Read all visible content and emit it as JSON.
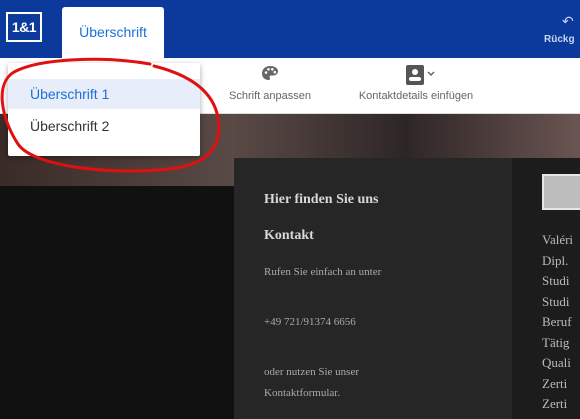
{
  "header": {
    "logo_text": "1&1",
    "active_tab": "Überschrift",
    "undo_label": "Rückg"
  },
  "toolbar": {
    "font_label": "Schrift anpassen",
    "contact_label": "Kontaktdetails einfügen"
  },
  "dropdown": {
    "items": [
      "Überschrift 1",
      "Überschrift 2"
    ],
    "selected": "Überschrift 1"
  },
  "content": {
    "heading_find": "Hier finden Sie uns",
    "heading_contact": "Kontakt",
    "call_text": "Rufen Sie einfach an unter",
    "phone": "+49 721/91374 6656",
    "or_text": "oder nutzen Sie unser",
    "form_text": "Kontaktformular."
  },
  "right_list": [
    "Valéri",
    "Dipl.",
    "Studi",
    "Studi",
    "Beruf",
    "Tätig",
    "Quali",
    "Zerti",
    "Zerti"
  ],
  "colors": {
    "header_bg": "#0b3a9c",
    "accent": "#1a6fd8",
    "annotation": "#e01010"
  }
}
